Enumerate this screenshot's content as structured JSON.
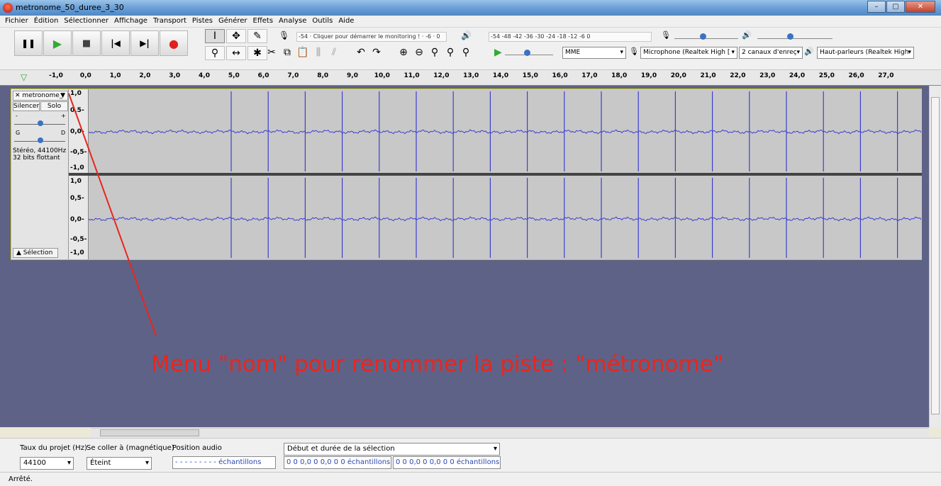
{
  "window": {
    "title": "metronome_50_duree_3_30",
    "min_label": "–",
    "max_label": "▢",
    "close_label": "✕"
  },
  "menu": [
    "Fichier",
    "Édition",
    "Sélectionner",
    "Affichage",
    "Transport",
    "Pistes",
    "Générer",
    "Effets",
    "Analyse",
    "Outils",
    "Aide"
  ],
  "transport": {
    "pause": "❚❚",
    "play": "▶",
    "stop": "■",
    "skip_start": "|◀",
    "skip_end": "▶|",
    "record": "●"
  },
  "meters": {
    "record_label": "G\nD",
    "record_scale": "-54 · Cliquer pour démarrer le monitoring ! · -6 · 0",
    "play_scale": "-54  -48  -42  -36  -30  -24  -18  -12  -6  0"
  },
  "devices": {
    "host": "MME",
    "microphone": "Microphone (Realtek High [",
    "channels": "2 canaux d'enreç",
    "speakers": "Haut-parleurs (Realtek High"
  },
  "ruler": {
    "ticks": [
      "-1,0",
      "0,0",
      "1,0",
      "2,0",
      "3,0",
      "4,0",
      "5,0",
      "6,0",
      "7,0",
      "8,0",
      "9,0",
      "10,0",
      "11,0",
      "12,0",
      "13,0",
      "14,0",
      "15,0",
      "16,0",
      "17,0",
      "18,0",
      "19,0",
      "20,0",
      "21,0",
      "22,0",
      "23,0",
      "24,0",
      "25,0",
      "26,0",
      "27,0"
    ]
  },
  "track": {
    "name": "metronome_",
    "mute": "Silencer",
    "solo": "Solo",
    "gain_minus": "-",
    "gain_plus": "+",
    "pan_left": "G",
    "pan_right": "D",
    "info_line1": "Stéréo, 44100Hz",
    "info_line2": "32 bits flottant",
    "select_button": "Sélection",
    "vruler_top": [
      "1,0",
      "0,5-",
      "0,0-",
      "-0,5-",
      "-1,0"
    ],
    "vruler_bottom": [
      "1,0",
      "0,5-",
      "0,0-",
      "-0,5-",
      "-1,0"
    ]
  },
  "bottom": {
    "project_rate_label": "Taux du projet (Hz)",
    "project_rate": "44100",
    "snap_label": "Se coller à (magnétique)",
    "snap_value": "Éteint",
    "audio_pos_label": "Position audio",
    "audio_pos_value": "- - - - - - - - - échantillons",
    "selection_label": "Début et durée de la sélection",
    "sel_start": "0 0 0,0 0 0,0 0 0 échantillons",
    "sel_end": "0 0 0,0 0 0,0 0 0 échantillons"
  },
  "status": "Arrêté.",
  "annotation": "Menu \"nom\" pour renommer la piste : \"métronome\"",
  "colors": {
    "wave": "#3b3fcf",
    "annotation": "#e8261e",
    "track_bg": "#5f6287"
  }
}
